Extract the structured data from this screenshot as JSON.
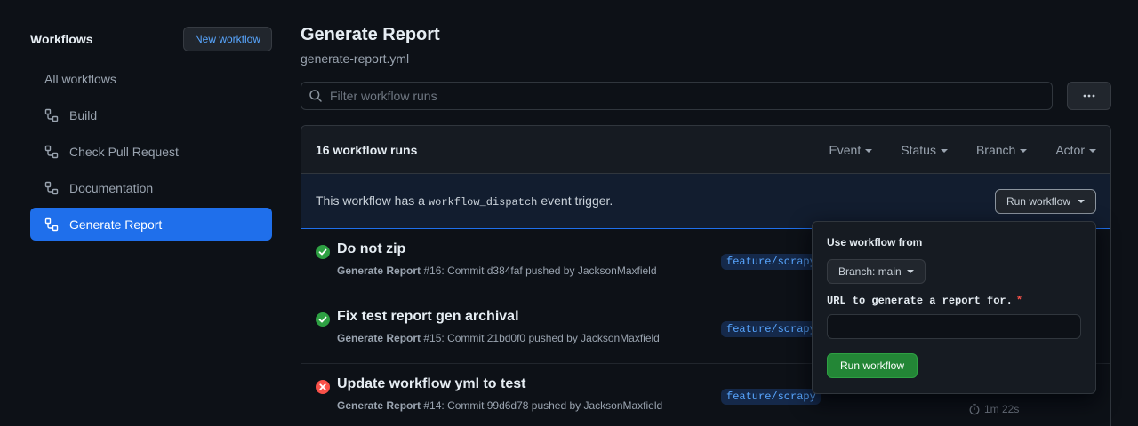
{
  "sidebar": {
    "title": "Workflows",
    "new_workflow_label": "New workflow",
    "items": [
      {
        "label": "All workflows"
      },
      {
        "label": "Build"
      },
      {
        "label": "Check Pull Request"
      },
      {
        "label": "Documentation"
      },
      {
        "label": "Generate Report"
      }
    ]
  },
  "header": {
    "title": "Generate Report",
    "subtitle": "generate-report.yml"
  },
  "filter": {
    "placeholder": "Filter workflow runs"
  },
  "runs": {
    "count_label": "16 workflow runs",
    "filters": [
      "Event",
      "Status",
      "Branch",
      "Actor"
    ],
    "dispatch": {
      "text_before": "This workflow has a",
      "code": "workflow_dispatch",
      "text_after": "event trigger.",
      "button_label": "Run workflow"
    },
    "rows": [
      {
        "title": "Do not zip",
        "workflow": "Generate Report",
        "meta": "#16: Commit d384faf pushed by JacksonMaxfield",
        "branch": "feature/scrapy",
        "status": "success"
      },
      {
        "title": "Fix test report gen archival",
        "workflow": "Generate Report",
        "meta": "#15: Commit 21bd0f0 pushed by JacksonMaxfield",
        "branch": "feature/scrapy",
        "status": "success"
      },
      {
        "title": "Update workflow yml to test",
        "workflow": "Generate Report",
        "meta": "#14: Commit 99d6d78 pushed by JacksonMaxfield",
        "branch": "feature/scrapy",
        "status": "failure",
        "duration": "1m 22s"
      }
    ]
  },
  "popover": {
    "title": "Use workflow from",
    "branch_label": "Branch: main",
    "input_label": "URL to generate a report for.",
    "required_mark": "*",
    "submit_label": "Run workflow"
  },
  "colors": {
    "accent": "#1f6feb",
    "success": "#2ea043",
    "failure": "#f85149"
  }
}
